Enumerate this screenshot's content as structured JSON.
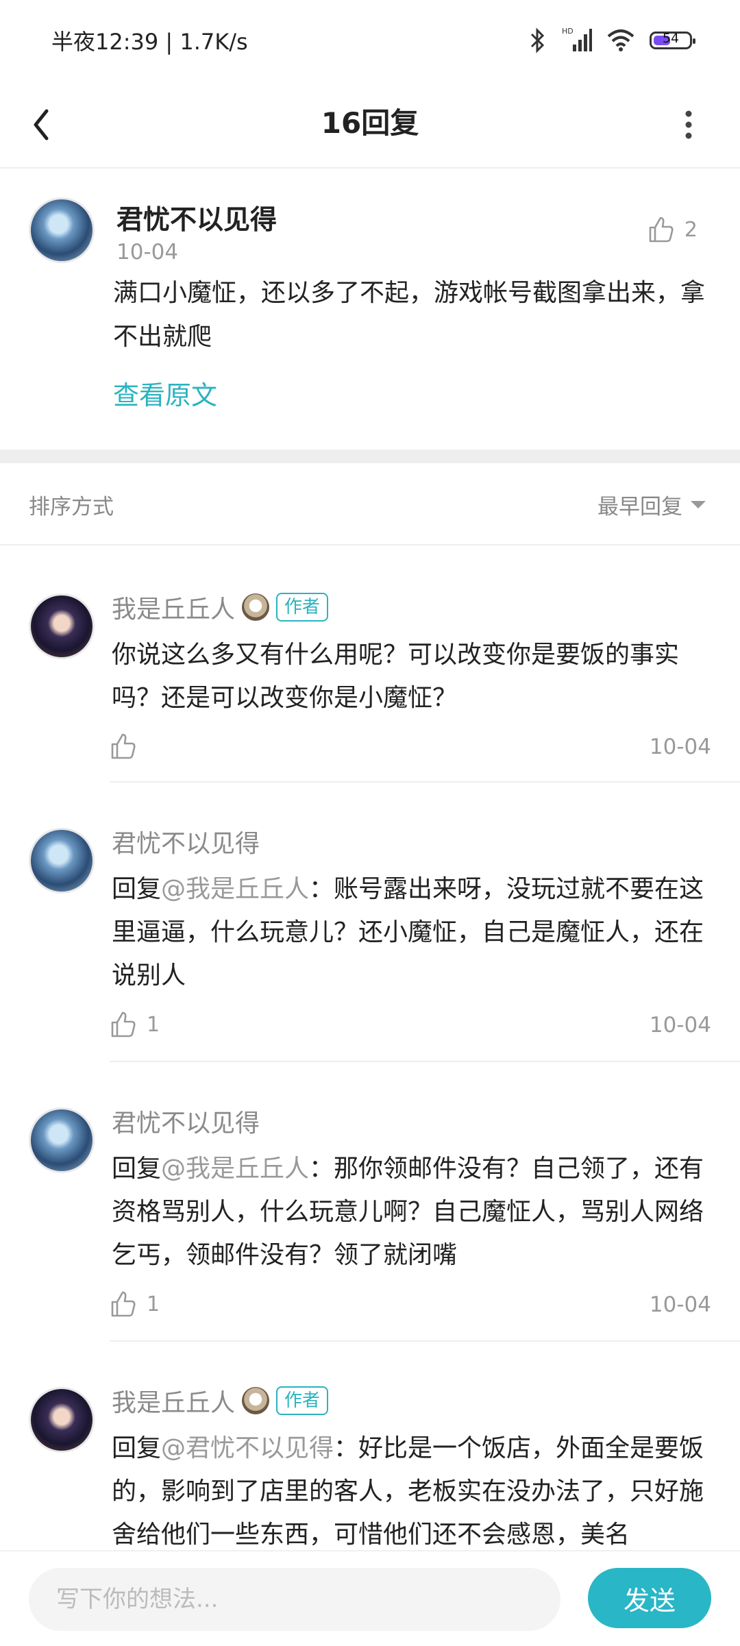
{
  "status_bar": {
    "time_text": "半夜12:39 | 1.7K/s",
    "battery_level": "54",
    "hd_label": "HD"
  },
  "header": {
    "title": "16回复"
  },
  "post": {
    "author": "君忧不以见得",
    "date": "10-04",
    "likes": "2",
    "content": "满口小魔怔，还以多了不起，游戏帐号截图拿出来，拿不出就爬",
    "view_original": "查看原文"
  },
  "sort": {
    "label": "排序方式",
    "selected": "最早回复"
  },
  "replies": [
    {
      "author": "我是丘丘人",
      "tag": "作者",
      "mention": "",
      "text": "你说这么多又有什么用呢？可以改变你是要饭的事实吗？还是可以改变你是小魔怔？",
      "likes": "",
      "date": "10-04"
    },
    {
      "author": "君忧不以见得",
      "tag": "",
      "reply_prefix": "回复",
      "mention": "@我是丘丘人",
      "text": "：账号露出来呀，没玩过就不要在这里逼逼，什么玩意儿？还小魔怔，自己是魔怔人，还在说别人",
      "likes": "1",
      "date": "10-04"
    },
    {
      "author": "君忧不以见得",
      "tag": "",
      "reply_prefix": "回复",
      "mention": "@我是丘丘人",
      "text": "：那你领邮件没有？自己领了，还有资格骂别人，什么玩意儿啊？自己魔怔人，骂别人网络乞丐，领邮件没有？领了就闭嘴",
      "likes": "1",
      "date": "10-04"
    },
    {
      "author": "我是丘丘人",
      "tag": "作者",
      "reply_prefix": "回复",
      "mention": "@君忧不以见得",
      "text": "：好比是一个饭店，外面全是要饭的，影响到了店里的客人，老板实在没办法了，只好施舍给他们一些东西，可惜他们还不会感恩，美名",
      "likes": "",
      "date": ""
    }
  ],
  "composer": {
    "placeholder": "写下你的想法...",
    "send_label": "发送"
  }
}
